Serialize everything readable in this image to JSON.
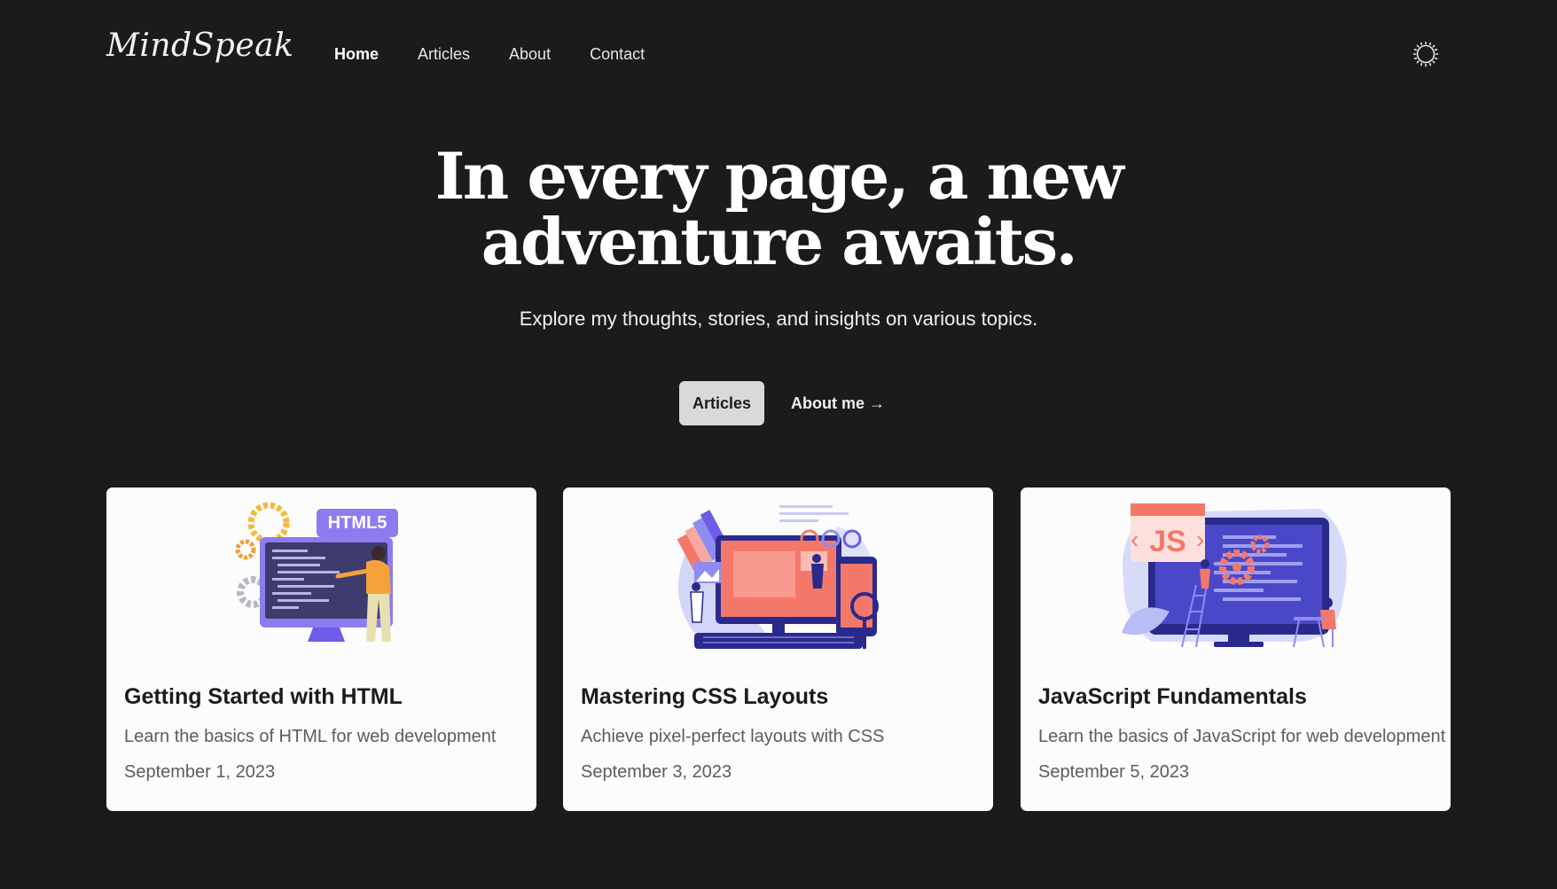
{
  "brand": {
    "logo_text": "MindSpeak"
  },
  "nav": {
    "items": [
      {
        "label": "Home",
        "active": true
      },
      {
        "label": "Articles",
        "active": false
      },
      {
        "label": "About",
        "active": false
      },
      {
        "label": "Contact",
        "active": false
      }
    ]
  },
  "theme_toggle": {
    "icon": "sun-icon"
  },
  "hero": {
    "title_line1": "In every page, a new",
    "title_line2": "adventure awaits.",
    "subtitle": "Explore my thoughts, stories, and insights on various topics.",
    "primary_button": "Articles",
    "secondary_link": "About me →"
  },
  "articles": [
    {
      "title": "Getting Started with HTML",
      "description": "Learn the basics of HTML for web development",
      "date": "September 1, 2023",
      "badge": "HTML5"
    },
    {
      "title": "Mastering CSS Layouts",
      "description": "Achieve pixel-perfect layouts with CSS",
      "date": "September 3, 2023"
    },
    {
      "title": "JavaScript Fundamentals",
      "description": "Learn the basics of JavaScript for web development",
      "date": "September 5, 2023",
      "badge": "JS"
    }
  ],
  "colors": {
    "background": "#1b1b1d",
    "card": "#fcfcfd",
    "primary_button": "#d9d9dc",
    "illustration_purple": "#6d5ce8",
    "illustration_coral": "#f4786a",
    "illustration_navy": "#2a2a8c"
  }
}
